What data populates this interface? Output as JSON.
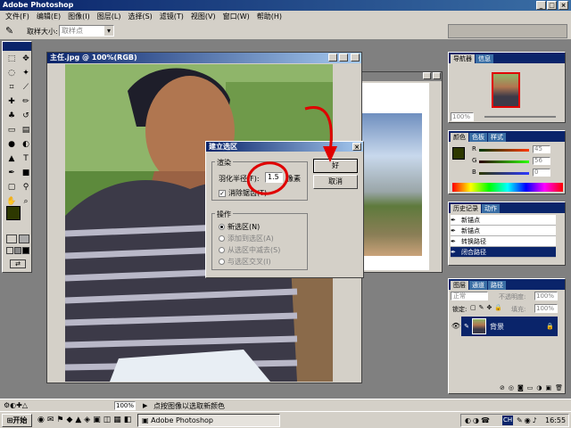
{
  "app": {
    "title": "Adobe Photoshop"
  },
  "menu": [
    "文件(F)",
    "编辑(E)",
    "图像(I)",
    "图层(L)",
    "选择(S)",
    "滤镜(T)",
    "视图(V)",
    "窗口(W)",
    "帮助(H)"
  ],
  "options": {
    "sample_label": "取样大小:",
    "sample_value": "取样点"
  },
  "doc1": {
    "title": "主任.jpg @ 100%(RGB)"
  },
  "dialog": {
    "title": "建立选区",
    "render_group": "渲染",
    "feather_label": "羽化半径(F):",
    "feather_value": "1.5",
    "feather_unit": "像素",
    "antialias_label": "消除锯齿(T)",
    "ok": "好",
    "cancel": "取消",
    "op_group": "操作",
    "ops": [
      "新选区(N)",
      "添加到选区(A)",
      "从选区中减去(S)",
      "与选区交叉(I)"
    ]
  },
  "navigator": {
    "tabs": [
      "导航器",
      "信息"
    ],
    "zoom": "100%"
  },
  "color": {
    "tabs": [
      "颜色",
      "色板",
      "样式"
    ],
    "r": "45",
    "g": "56",
    "b": "0",
    "rl": "R",
    "gl": "G",
    "bl": "B"
  },
  "history": {
    "tabs": [
      "历史记录",
      "动作"
    ],
    "items": [
      "新锚点",
      "新锚点",
      "转换路径",
      "闭合路径"
    ]
  },
  "layers": {
    "tabs": [
      "图层",
      "通道",
      "路径"
    ],
    "mode": "正常",
    "opacity_label": "不透明度:",
    "opacity": "100%",
    "lock_label": "锁定:",
    "fill_label": "填充:",
    "fill": "100%",
    "layer_name": "背景"
  },
  "status": {
    "zoom": "100%",
    "hint": "点按图像以选取新颜色"
  },
  "taskbar": {
    "start": "开始",
    "task": "Adobe Photoshop",
    "clock": "16:55",
    "tray": "CH"
  },
  "colors": {
    "fg": "#2d3800",
    "accent": "#0a246a",
    "red_mark": "#e00000"
  }
}
